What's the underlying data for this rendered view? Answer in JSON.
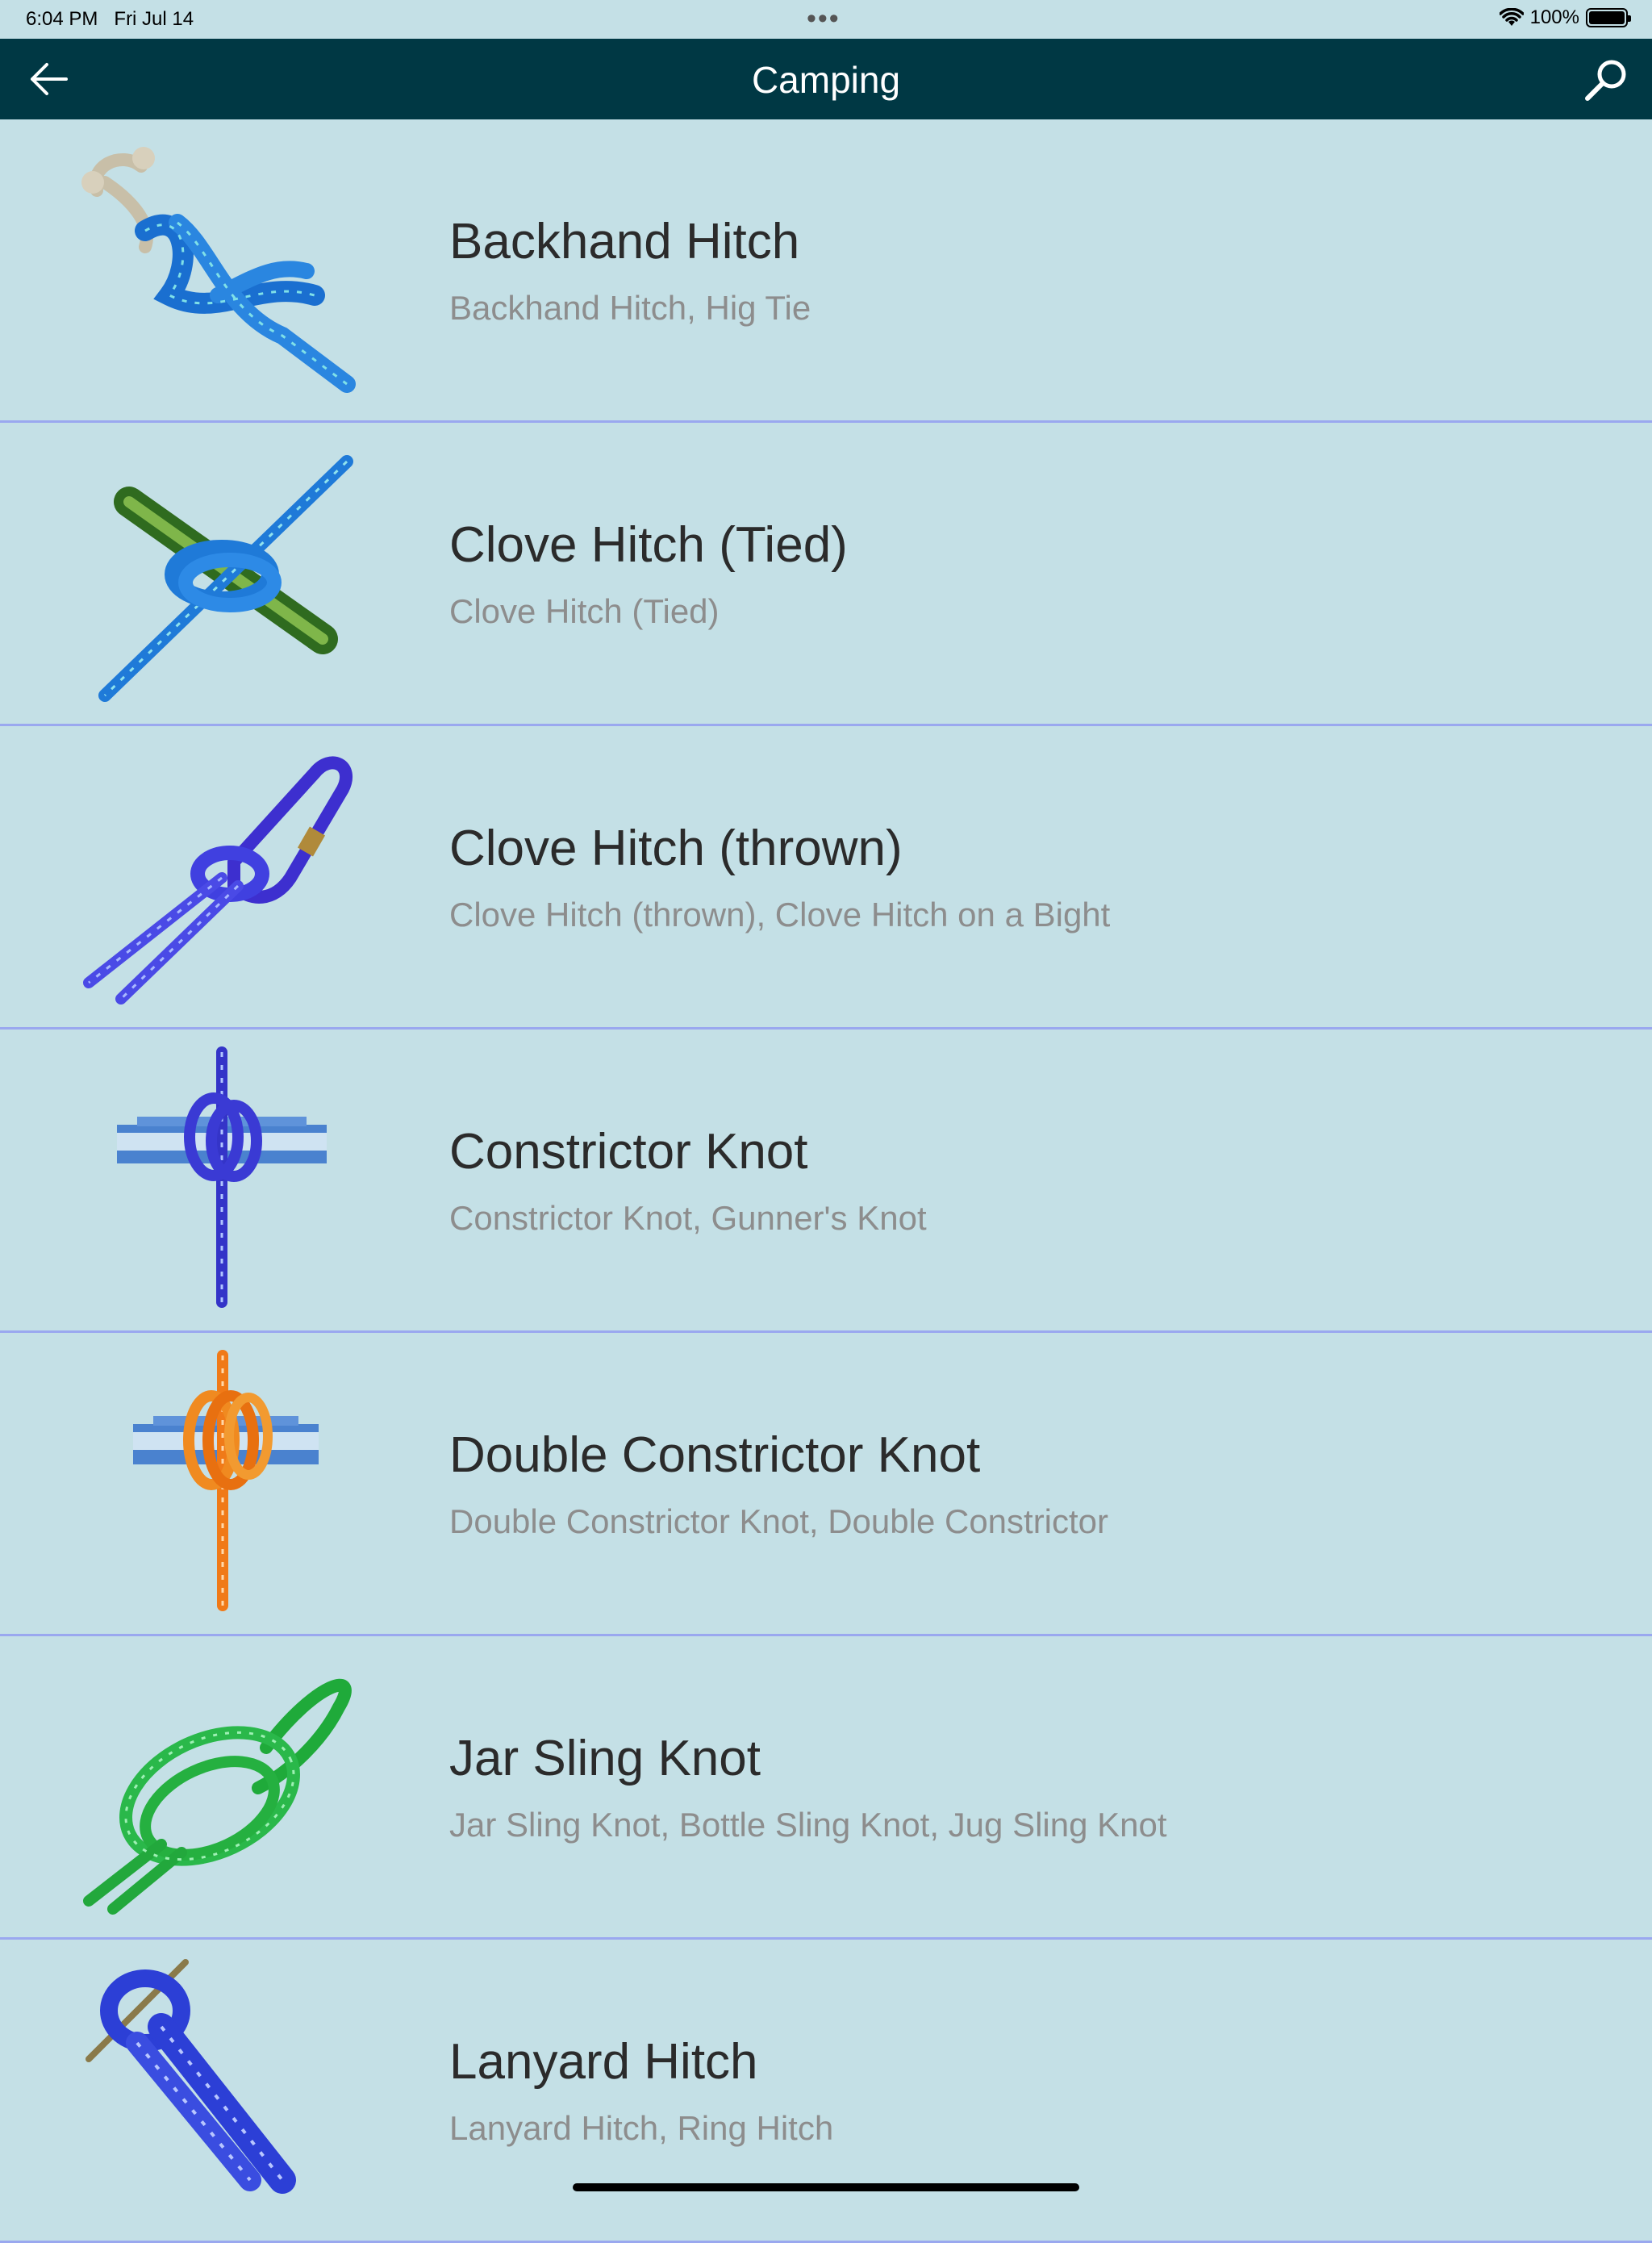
{
  "status_bar": {
    "time": "6:04 PM",
    "date": "Fri Jul 14",
    "dots": "•••",
    "battery_text": "100%",
    "wifi_icon": "wifi-icon",
    "battery_icon": "battery-icon"
  },
  "nav": {
    "title": "Camping",
    "back_icon": "arrow-left-icon",
    "search_icon": "search-icon",
    "bg_color": "#003844"
  },
  "knots": [
    {
      "title": "Backhand Hitch",
      "subtitle": "Backhand Hitch, Hig Tie",
      "image": "backhand-hitch-image"
    },
    {
      "title": "Clove Hitch (Tied)",
      "subtitle": "Clove Hitch (Tied)",
      "image": "clove-hitch-tied-image"
    },
    {
      "title": "Clove Hitch (thrown)",
      "subtitle": "Clove Hitch (thrown), Clove Hitch on a Bight",
      "image": "clove-hitch-thrown-image"
    },
    {
      "title": "Constrictor Knot",
      "subtitle": "Constrictor Knot, Gunner's Knot",
      "image": "constrictor-knot-image"
    },
    {
      "title": "Double Constrictor Knot",
      "subtitle": "Double Constrictor Knot, Double Constrictor",
      "image": "double-constrictor-knot-image"
    },
    {
      "title": "Jar Sling Knot",
      "subtitle": "Jar Sling Knot, Bottle Sling Knot, Jug Sling Knot",
      "image": "jar-sling-knot-image"
    },
    {
      "title": "Lanyard Hitch",
      "subtitle": "Lanyard Hitch, Ring Hitch",
      "image": "lanyard-hitch-image"
    }
  ],
  "colors": {
    "background": "#c4e0e6",
    "divider": "#9aa8ef",
    "title_text": "#2b2b2b",
    "subtitle_text": "#8d8d8d"
  }
}
